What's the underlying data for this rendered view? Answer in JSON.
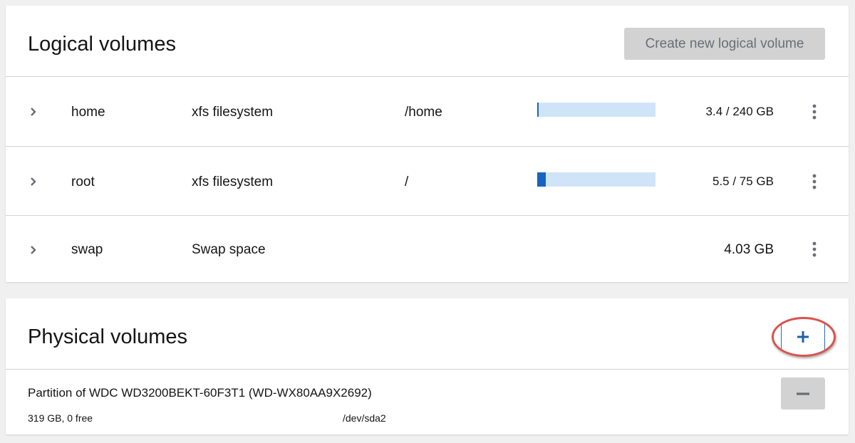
{
  "logical_volumes": {
    "title": "Logical volumes",
    "create_button_label": "Create new logical volume",
    "rows": [
      {
        "name": "home",
        "type": "xfs filesystem",
        "mount": "/home",
        "usage_fraction": 0.014,
        "size": "3.4 / 240 GB"
      },
      {
        "name": "root",
        "type": "xfs filesystem",
        "mount": "/",
        "usage_fraction": 0.073,
        "size": "5.5 / 75 GB"
      },
      {
        "name": "swap",
        "type": "Swap space",
        "mount": "",
        "size": "4.03 GB"
      }
    ]
  },
  "physical_volumes": {
    "title": "Physical volumes",
    "add_button_icon": "plus-icon",
    "remove_button_icon": "minus-icon",
    "items": [
      {
        "name": "Partition of WDC WD3200BEKT-60F3T1 (WD-WX80AA9X2692)",
        "free": "319 GB, 0 free",
        "device": "/dev/sda2"
      }
    ]
  },
  "colors": {
    "usage_fill": "#1664c0",
    "usage_track": "#d0e4f7",
    "highlight_ring": "#d9534f",
    "add_icon": "#2b6cb0"
  }
}
